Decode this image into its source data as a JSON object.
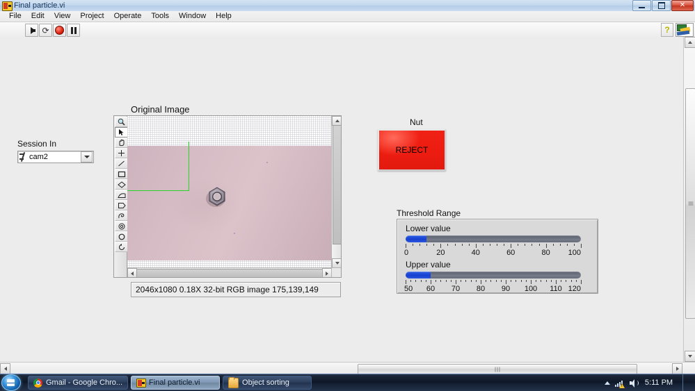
{
  "window": {
    "title": "Final particle.vi",
    "icon": "labview-vi-icon",
    "buttons": {
      "minimize": "minimize-button",
      "maximize": "maximize-button",
      "close": "close-button"
    }
  },
  "menubar": {
    "items": [
      "File",
      "Edit",
      "View",
      "Project",
      "Operate",
      "Tools",
      "Window",
      "Help"
    ]
  },
  "toolbar": {
    "buttons": [
      {
        "name": "run-button",
        "icon": "run-arrow-icon"
      },
      {
        "name": "run-continuously-button",
        "icon": "run-continuously-icon"
      },
      {
        "name": "abort-execution-button",
        "icon": "abort-stop-icon"
      },
      {
        "name": "pause-button",
        "icon": "pause-icon"
      }
    ],
    "help_button": "?",
    "lv_badge": "labview-search-icon"
  },
  "panel": {
    "session": {
      "label": "Session In",
      "value": "cam2",
      "icon": "visa-resource-icon",
      "dropdown": "chevron-down-icon"
    },
    "image_display": {
      "title": "Original Image",
      "status": "2046x1080 0.18X 32-bit RGB image 175,139,149",
      "tools": [
        "zoom-tool",
        "selection-cursor-tool",
        "pan-hand-tool",
        "point-tool",
        "line-tool",
        "rectangle-tool",
        "rotated-rectangle-tool",
        "polygon-tool",
        "broken-line-tool",
        "freehand-region-tool",
        "annulus-tool",
        "oval-tool",
        "rotate-tool"
      ],
      "selected_tool": "selection-cursor-tool"
    },
    "nut_indicator": {
      "label": "Nut",
      "value": "REJECT",
      "color": "#ed1c10"
    },
    "threshold": {
      "label": "Threshold Range",
      "lower": {
        "name": "Lower value",
        "value": 12,
        "min": 0,
        "max": 100,
        "ticks": [
          0,
          20,
          40,
          60,
          80,
          100
        ]
      },
      "upper": {
        "name": "Upper value",
        "value": 60,
        "min": 50,
        "max": 120,
        "ticks": [
          50,
          60,
          70,
          80,
          90,
          100,
          110,
          120
        ]
      }
    }
  },
  "taskbar": {
    "start": "windows-start-orb",
    "items": [
      {
        "label": "Gmail - Google Chro...",
        "icon": "chrome-icon",
        "active": false
      },
      {
        "label": "Final particle.vi",
        "icon": "labview-vi-icon",
        "active": true
      },
      {
        "label": "Object sorting",
        "icon": "folder-icon",
        "active": false
      }
    ],
    "tray": {
      "show_hidden": "show-hidden-icons-chevron",
      "network": "network-warning-icon",
      "volume": "volume-icon",
      "clock": "5:11 PM"
    }
  }
}
